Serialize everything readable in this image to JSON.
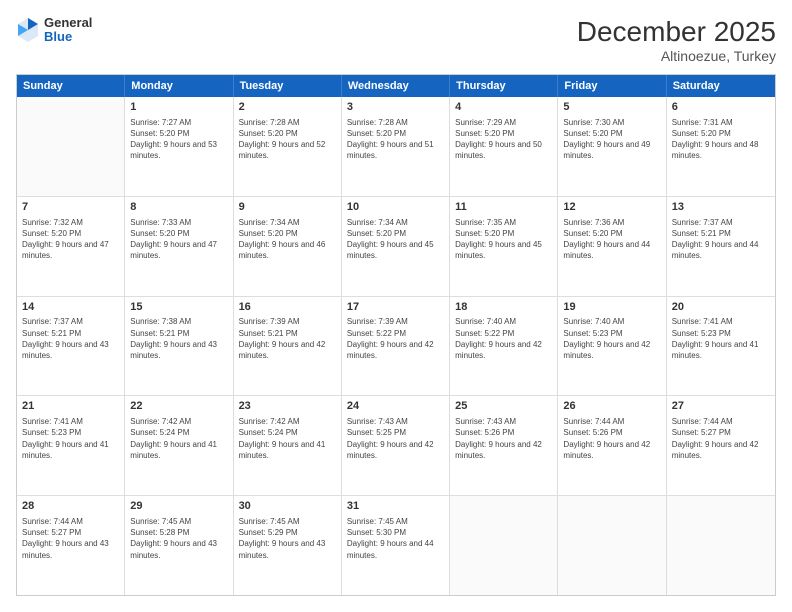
{
  "header": {
    "logo_general": "General",
    "logo_blue": "Blue",
    "month_title": "December 2025",
    "subtitle": "Altinoezue, Turkey"
  },
  "days_of_week": [
    "Sunday",
    "Monday",
    "Tuesday",
    "Wednesday",
    "Thursday",
    "Friday",
    "Saturday"
  ],
  "weeks": [
    [
      {
        "day": "",
        "sunrise": "",
        "sunset": "",
        "daylight": ""
      },
      {
        "day": "1",
        "sunrise": "Sunrise: 7:27 AM",
        "sunset": "Sunset: 5:20 PM",
        "daylight": "Daylight: 9 hours and 53 minutes."
      },
      {
        "day": "2",
        "sunrise": "Sunrise: 7:28 AM",
        "sunset": "Sunset: 5:20 PM",
        "daylight": "Daylight: 9 hours and 52 minutes."
      },
      {
        "day": "3",
        "sunrise": "Sunrise: 7:28 AM",
        "sunset": "Sunset: 5:20 PM",
        "daylight": "Daylight: 9 hours and 51 minutes."
      },
      {
        "day": "4",
        "sunrise": "Sunrise: 7:29 AM",
        "sunset": "Sunset: 5:20 PM",
        "daylight": "Daylight: 9 hours and 50 minutes."
      },
      {
        "day": "5",
        "sunrise": "Sunrise: 7:30 AM",
        "sunset": "Sunset: 5:20 PM",
        "daylight": "Daylight: 9 hours and 49 minutes."
      },
      {
        "day": "6",
        "sunrise": "Sunrise: 7:31 AM",
        "sunset": "Sunset: 5:20 PM",
        "daylight": "Daylight: 9 hours and 48 minutes."
      }
    ],
    [
      {
        "day": "7",
        "sunrise": "Sunrise: 7:32 AM",
        "sunset": "Sunset: 5:20 PM",
        "daylight": "Daylight: 9 hours and 47 minutes."
      },
      {
        "day": "8",
        "sunrise": "Sunrise: 7:33 AM",
        "sunset": "Sunset: 5:20 PM",
        "daylight": "Daylight: 9 hours and 47 minutes."
      },
      {
        "day": "9",
        "sunrise": "Sunrise: 7:34 AM",
        "sunset": "Sunset: 5:20 PM",
        "daylight": "Daylight: 9 hours and 46 minutes."
      },
      {
        "day": "10",
        "sunrise": "Sunrise: 7:34 AM",
        "sunset": "Sunset: 5:20 PM",
        "daylight": "Daylight: 9 hours and 45 minutes."
      },
      {
        "day": "11",
        "sunrise": "Sunrise: 7:35 AM",
        "sunset": "Sunset: 5:20 PM",
        "daylight": "Daylight: 9 hours and 45 minutes."
      },
      {
        "day": "12",
        "sunrise": "Sunrise: 7:36 AM",
        "sunset": "Sunset: 5:20 PM",
        "daylight": "Daylight: 9 hours and 44 minutes."
      },
      {
        "day": "13",
        "sunrise": "Sunrise: 7:37 AM",
        "sunset": "Sunset: 5:21 PM",
        "daylight": "Daylight: 9 hours and 44 minutes."
      }
    ],
    [
      {
        "day": "14",
        "sunrise": "Sunrise: 7:37 AM",
        "sunset": "Sunset: 5:21 PM",
        "daylight": "Daylight: 9 hours and 43 minutes."
      },
      {
        "day": "15",
        "sunrise": "Sunrise: 7:38 AM",
        "sunset": "Sunset: 5:21 PM",
        "daylight": "Daylight: 9 hours and 43 minutes."
      },
      {
        "day": "16",
        "sunrise": "Sunrise: 7:39 AM",
        "sunset": "Sunset: 5:21 PM",
        "daylight": "Daylight: 9 hours and 42 minutes."
      },
      {
        "day": "17",
        "sunrise": "Sunrise: 7:39 AM",
        "sunset": "Sunset: 5:22 PM",
        "daylight": "Daylight: 9 hours and 42 minutes."
      },
      {
        "day": "18",
        "sunrise": "Sunrise: 7:40 AM",
        "sunset": "Sunset: 5:22 PM",
        "daylight": "Daylight: 9 hours and 42 minutes."
      },
      {
        "day": "19",
        "sunrise": "Sunrise: 7:40 AM",
        "sunset": "Sunset: 5:23 PM",
        "daylight": "Daylight: 9 hours and 42 minutes."
      },
      {
        "day": "20",
        "sunrise": "Sunrise: 7:41 AM",
        "sunset": "Sunset: 5:23 PM",
        "daylight": "Daylight: 9 hours and 41 minutes."
      }
    ],
    [
      {
        "day": "21",
        "sunrise": "Sunrise: 7:41 AM",
        "sunset": "Sunset: 5:23 PM",
        "daylight": "Daylight: 9 hours and 41 minutes."
      },
      {
        "day": "22",
        "sunrise": "Sunrise: 7:42 AM",
        "sunset": "Sunset: 5:24 PM",
        "daylight": "Daylight: 9 hours and 41 minutes."
      },
      {
        "day": "23",
        "sunrise": "Sunrise: 7:42 AM",
        "sunset": "Sunset: 5:24 PM",
        "daylight": "Daylight: 9 hours and 41 minutes."
      },
      {
        "day": "24",
        "sunrise": "Sunrise: 7:43 AM",
        "sunset": "Sunset: 5:25 PM",
        "daylight": "Daylight: 9 hours and 42 minutes."
      },
      {
        "day": "25",
        "sunrise": "Sunrise: 7:43 AM",
        "sunset": "Sunset: 5:26 PM",
        "daylight": "Daylight: 9 hours and 42 minutes."
      },
      {
        "day": "26",
        "sunrise": "Sunrise: 7:44 AM",
        "sunset": "Sunset: 5:26 PM",
        "daylight": "Daylight: 9 hours and 42 minutes."
      },
      {
        "day": "27",
        "sunrise": "Sunrise: 7:44 AM",
        "sunset": "Sunset: 5:27 PM",
        "daylight": "Daylight: 9 hours and 42 minutes."
      }
    ],
    [
      {
        "day": "28",
        "sunrise": "Sunrise: 7:44 AM",
        "sunset": "Sunset: 5:27 PM",
        "daylight": "Daylight: 9 hours and 43 minutes."
      },
      {
        "day": "29",
        "sunrise": "Sunrise: 7:45 AM",
        "sunset": "Sunset: 5:28 PM",
        "daylight": "Daylight: 9 hours and 43 minutes."
      },
      {
        "day": "30",
        "sunrise": "Sunrise: 7:45 AM",
        "sunset": "Sunset: 5:29 PM",
        "daylight": "Daylight: 9 hours and 43 minutes."
      },
      {
        "day": "31",
        "sunrise": "Sunrise: 7:45 AM",
        "sunset": "Sunset: 5:30 PM",
        "daylight": "Daylight: 9 hours and 44 minutes."
      },
      {
        "day": "",
        "sunrise": "",
        "sunset": "",
        "daylight": ""
      },
      {
        "day": "",
        "sunrise": "",
        "sunset": "",
        "daylight": ""
      },
      {
        "day": "",
        "sunrise": "",
        "sunset": "",
        "daylight": ""
      }
    ]
  ]
}
